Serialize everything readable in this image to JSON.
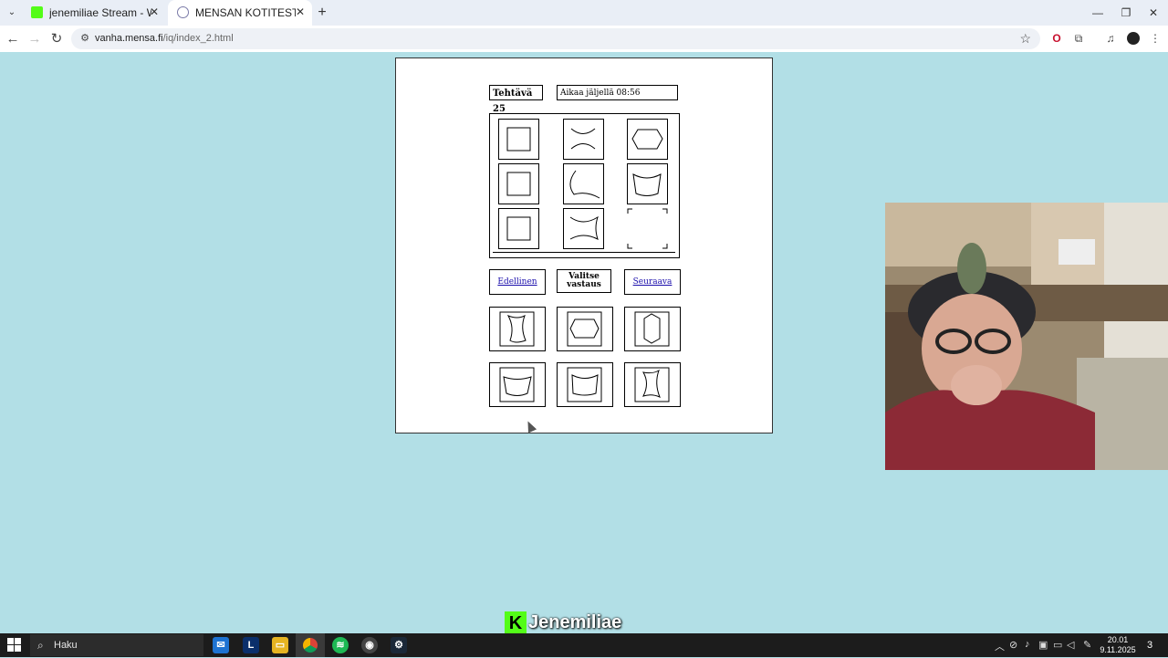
{
  "browser": {
    "tabs": [
      {
        "title": "jenemiliae Stream - Watch Live"
      },
      {
        "title": "MENSAN KOTITESTI"
      }
    ],
    "url_host": "vanha.mensa.fi",
    "url_path": "/iq/index_2.html"
  },
  "test": {
    "task_label": "Tehtävä 25",
    "timer_text": "Aikaa jäljellä 08:56",
    "prev_label": "Edellinen",
    "choose_label": "Valitse vastaus",
    "next_label": "Seuraava"
  },
  "watermark": {
    "logo": "K",
    "name": "Jenemiliae"
  },
  "taskbar": {
    "search_placeholder": "Haku",
    "time": "20.01",
    "date": "9.11.2025",
    "notification_count": "3"
  }
}
